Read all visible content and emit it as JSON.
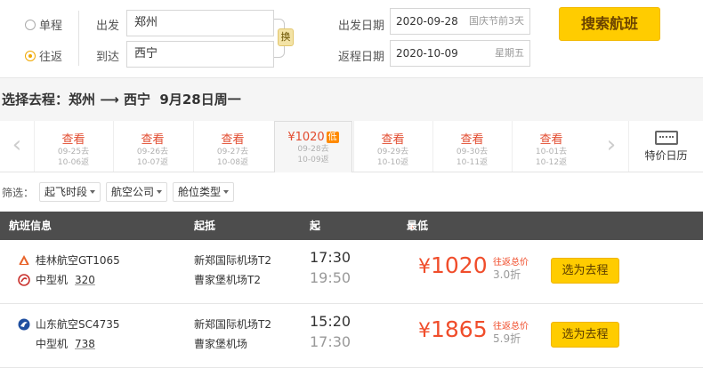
{
  "search": {
    "one_way_label": "单程",
    "round_trip_label": "往返",
    "from_label": "出发",
    "to_label": "到达",
    "from_value": "郑州",
    "to_value": "西宁",
    "swap_label": "换",
    "depart_label": "出发日期",
    "return_label": "返程日期",
    "depart_date": "2020-09-28",
    "depart_note": "国庆节前3天",
    "return_date": "2020-10-09",
    "return_note": "星期五",
    "search_button": "搜索航班"
  },
  "title": {
    "prefix": "选择去程：",
    "route": "郑州 ⟶ 西宁",
    "date": "9月28日周一"
  },
  "date_strip": {
    "cells": [
      {
        "price": "查看",
        "dep": "09-25去",
        "ret": "10-06返"
      },
      {
        "price": "查看",
        "dep": "09-26去",
        "ret": "10-07返"
      },
      {
        "price": "查看",
        "dep": "09-27去",
        "ret": "10-08返"
      },
      {
        "price": "¥1020",
        "dep": "09-28去",
        "ret": "10-09返",
        "badge": "低"
      },
      {
        "price": "查看",
        "dep": "09-29去",
        "ret": "10-10返"
      },
      {
        "price": "查看",
        "dep": "09-30去",
        "ret": "10-11返"
      },
      {
        "price": "查看",
        "dep": "10-01去",
        "ret": "10-12返"
      }
    ],
    "calendar_label": "特价日历"
  },
  "filter": {
    "label": "筛选：",
    "options": [
      "起飞时段",
      "航空公司",
      "舱位类型"
    ]
  },
  "table_header": {
    "flight": "航班信息",
    "airports": "起抵",
    "times": "起抵时间",
    "price": "最低价格（不含税费）"
  },
  "flights": [
    {
      "airline": "桂林航空GT1065",
      "plane_size": "中型机",
      "model": "320",
      "dep_airport": "新郑国际机场T2",
      "arr_airport": "曹家堡机场T2",
      "dep_time": "17:30",
      "arr_time": "19:50",
      "currency": "¥",
      "price": "1020",
      "tag": "往返总价",
      "discount": "3.0折",
      "button": "选为去程",
      "icon_color": "#e8632a"
    },
    {
      "airline": "山东航空SC4735",
      "plane_size": "中型机",
      "model": "738",
      "dep_airport": "新郑国际机场T2",
      "arr_airport": "曹家堡机场",
      "dep_time": "15:20",
      "arr_time": "17:30",
      "currency": "¥",
      "price": "1865",
      "tag": "往返总价",
      "discount": "5.9折",
      "button": "选为去程",
      "icon_color": "#1f4fa0"
    }
  ]
}
